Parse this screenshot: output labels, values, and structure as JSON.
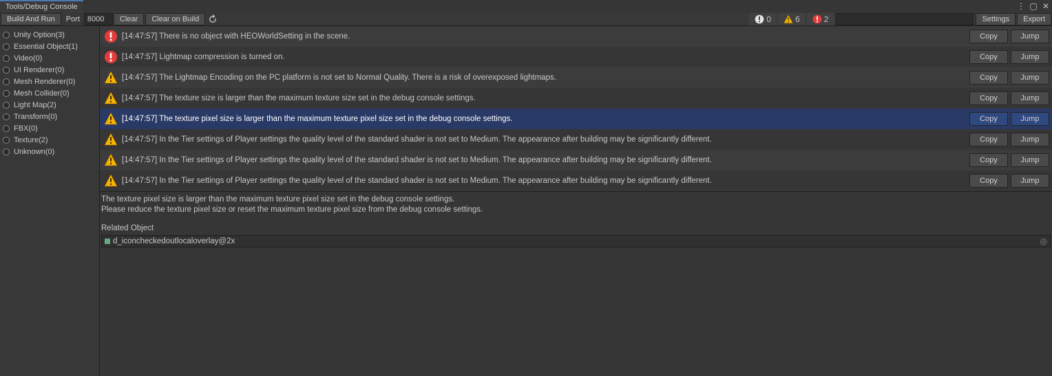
{
  "window": {
    "tab_title": "Tools/Debug Console"
  },
  "toolbar": {
    "build_and_run": "Build And Run",
    "port_label": "Port",
    "port_value": "8000",
    "clear": "Clear",
    "clear_on_build": "Clear on Build",
    "settings": "Settings",
    "export": "Export",
    "search_placeholder": "",
    "counts": {
      "info": "0",
      "warn": "6",
      "error": "2"
    }
  },
  "sidebar": {
    "items": [
      {
        "label": "Unity Option(3)"
      },
      {
        "label": "Essential Object(1)"
      },
      {
        "label": "Video(0)"
      },
      {
        "label": "UI Renderer(0)"
      },
      {
        "label": "Mesh Renderer(0)"
      },
      {
        "label": "Mesh Collider(0)"
      },
      {
        "label": "Light Map(2)"
      },
      {
        "label": "Transform(0)"
      },
      {
        "label": "FBX(0)"
      },
      {
        "label": "Texture(2)"
      },
      {
        "label": "Unknown(0)"
      }
    ]
  },
  "messages": [
    {
      "type": "error",
      "time": "[14:47:57]",
      "text": "There is no object with HEOWorldSetting in the scene.",
      "selected": false
    },
    {
      "type": "error",
      "time": "[14:47:57]",
      "text": "Lightmap compression is turned on.",
      "selected": false
    },
    {
      "type": "warn",
      "time": "[14:47:57]",
      "text": "The Lightmap Encoding on the PC platform is not set to Normal Quality. There is a risk of overexposed lightmaps.",
      "selected": false
    },
    {
      "type": "warn",
      "time": "[14:47:57]",
      "text": "The texture size is larger than the maximum texture size set in the debug console settings.",
      "selected": false
    },
    {
      "type": "warn",
      "time": "[14:47:57]",
      "text": "The texture pixel size is larger than the maximum texture pixel size set in the debug console settings.",
      "selected": true
    },
    {
      "type": "warn",
      "time": "[14:47:57]",
      "text": "In the Tier settings of Player settings the quality level of the standard shader is not set to Medium. The appearance after building may be significantly different.",
      "selected": false
    },
    {
      "type": "warn",
      "time": "[14:47:57]",
      "text": "In the Tier settings of Player settings the quality level of the standard shader is not set to Medium. The appearance after building may be significantly different.",
      "selected": false
    },
    {
      "type": "warn",
      "time": "[14:47:57]",
      "text": "In the Tier settings of Player settings the quality level of the standard shader is not set to Medium. The appearance after building may be significantly different.",
      "selected": false
    }
  ],
  "row_buttons": {
    "copy": "Copy",
    "jump": "Jump"
  },
  "detail": {
    "line1": "The texture pixel size is larger than the maximum texture pixel size set in the debug console settings.",
    "line2": "Please reduce the texture pixel size or reset the maximum texture pixel size from the debug console settings.",
    "related_label": "Related Object",
    "related_object": "d_iconcheckedoutlocaloverlay@2x"
  }
}
